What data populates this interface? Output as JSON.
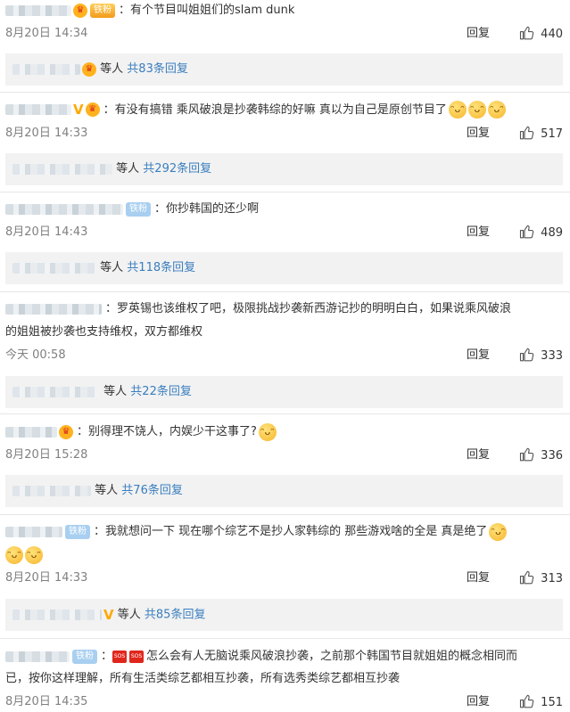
{
  "comments": [
    {
      "badge": "铁粉",
      "text": "：有个节目叫姐姐们的slam dunk",
      "time": "8月20日 14:34",
      "reply": "回复",
      "likes": "440",
      "sub": {
        "prefix": "等人",
        "link": "共83条回复"
      }
    },
    {
      "text": "：有没有搞错 乘风破浪是抄袭韩综的好嘛 真以为自己是原创节目了",
      "time": "8月20日 14:33",
      "reply": "回复",
      "likes": "517",
      "sub": {
        "prefix": "等人",
        "link": "共292条回复"
      }
    },
    {
      "badge": "铁粉",
      "text": "：你抄韩国的还少啊",
      "time": "8月20日 14:43",
      "reply": "回复",
      "likes": "489",
      "sub": {
        "prefix": "等人",
        "link": "共118条回复"
      }
    },
    {
      "text1": "：罗英锡也该维权了吧，极限挑战抄袭新西游记抄的明明白白，如果说乘风破浪",
      "text2": "的姐姐被抄袭也支持维权，双方都维权",
      "time": "今天 00:58",
      "reply": "回复",
      "likes": "333",
      "sub": {
        "prefix": "等人",
        "link": "共22条回复"
      }
    },
    {
      "text": "：别得理不饶人，内娱少干这事了?",
      "time": "8月20日 15:28",
      "reply": "回复",
      "likes": "336",
      "sub": {
        "prefix": "等人",
        "link": "共76条回复"
      }
    },
    {
      "badge": "铁粉",
      "text": "：我就想问一下 现在哪个综艺不是抄人家韩综的 那些游戏啥的全是 真是绝了",
      "time": "8月20日 14:33",
      "reply": "回复",
      "likes": "313",
      "sub": {
        "prefix": "等人",
        "link": "共85条回复"
      }
    },
    {
      "badge": "铁粉",
      "text1": "怎么会有人无脑说乘风破浪抄袭，之前那个韩国节目就姐姐的概念相同而",
      "text2": "已，按你这样理解，所有生活类综艺都相互抄袭，所有选秀类综艺都相互抄袭",
      "time": "8月20日 14:35",
      "reply": "回复",
      "likes": "151"
    }
  ],
  "icons": {
    "like": "thumbs-up-icon",
    "vip": "crown-icon",
    "verified": "v-verified-icon",
    "emoji": "grin-sweat-emoji",
    "sos": "sos-icon"
  },
  "colors": {
    "link": "#3a7ebf",
    "sub_bg": "#f2f2f2",
    "time": "#808080",
    "badge_gold": "#f39b1c",
    "badge_blue": "#a8cff0"
  }
}
